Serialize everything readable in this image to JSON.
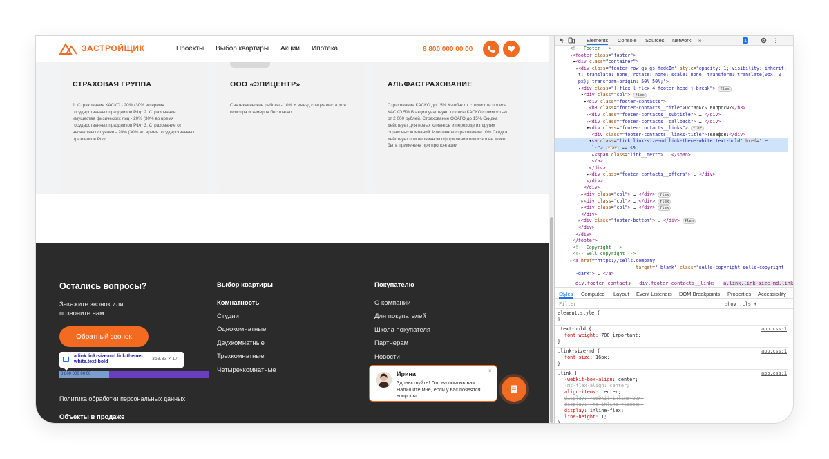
{
  "header": {
    "logo_text": "ЗАСТРОЙЩИК",
    "nav": [
      "Проекты",
      "Выбор квартиры",
      "Акции",
      "Ипотека"
    ],
    "phone": "8 800 000 00 00",
    "phone_icon": "phone-icon",
    "fav_icon": "heart-icon",
    "accent": "#f26b21"
  },
  "cards": [
    {
      "title": "СТРАХОВАЯ ГРУППА",
      "text": "1. Страхование КАСКО - 20% (30% во время государственных праздников РФ)* 2. Страхование имущества физических лиц - 20% (30% во время государственных праздников РФ)* 3. Страхование от несчастных случаев - 20% (30% во время государственных праздников РФ)*"
    },
    {
      "title": "ООО «ЭПИЦЕНТР»",
      "text": "Сантехнические работы - 10% + выезд специалиста для осмотра и замеров бесплатно"
    },
    {
      "title": "АЛЬФАСТРАХОВАНИЕ",
      "text": "Страхование КАСКО до 15% Кэшбэк от стоимости полиса КАСКО 5% В акции участвуют полисы КАСКО стоимостью от 2 000 рублей. Страхование ОСАГО до 15% Скидка действует для новых клиентов и переходе из других страховых компаний. Ипотечное страхование 10% Скидка действует при первичном оформлении полиса и не может быть применена при пролонгации"
    }
  ],
  "footer": {
    "questions_title": "Остались вопросы?",
    "questions_sub": "Закажите звонок или позвоните нам",
    "callback_btn": "Обратный звонок",
    "inspect_tooltip": {
      "name": "a.link.link-size-md.link-theme-white.text-bold",
      "dims": "363.33 × 17"
    },
    "highlighted_phone": "8 800 000 00 00",
    "policy_link": "Политика обработки персональных данных",
    "objects_title": "Объекты в продаже",
    "col_choice": {
      "title": "Выбор квартиры",
      "group": "Комнатность",
      "items": [
        "Студии",
        "Однокомнатные",
        "Двухкомнатные",
        "Трехкомнатные",
        "Четырехкомнатные"
      ]
    },
    "col_buyer": {
      "title": "Покупателю",
      "items": [
        "О компании",
        "Для покупателей",
        "Школа покупателя",
        "Партнерам",
        "Новости"
      ]
    }
  },
  "chat": {
    "name": "Ирина",
    "message": "Здравствуйте! Готова помочь вам. Напишите мне, если у вас появятся вопросы.",
    "close": "×",
    "button_icon": "chat-icon"
  },
  "devtools": {
    "tabs": [
      "Elements",
      "Console",
      "Sources",
      "Network",
      "»"
    ],
    "badge": "1",
    "dom_lines": [
      {
        "html": "<span class='cm'>&lt;!-- Footer --&gt;</span>"
      },
      {
        "html": "▾<span class='tg'>&lt;footer</span> <span class='at'>class</span>=<span class='av2'>\"footer\"</span><span class='tg'>&gt;</span>"
      },
      {
        "html": "&nbsp;▾<span class='tg'>&lt;div</span> <span class='at'>class</span>=<span class='av2'>\"container\"</span><span class='tg'>&gt;</span>"
      },
      {
        "html": "&nbsp;&nbsp;▾<span class='tg'>&lt;div</span> <span class='at'>class</span>=<span class='av2'>\"footer-row gs gs-fadeIn\"</span> <span class='at'>style</span>=<span class='av2'>\"opacity: 1; visibility: inherit;</span>"
      },
      {
        "html": "&nbsp;&nbsp;&nbsp;<span class='av2'>t; translate: none; rotate: none; scale: none; transform: translate(0px, 0</span>"
      },
      {
        "html": "&nbsp;&nbsp;&nbsp;<span class='av2'>px); transform-origin: 50% 50%;\"</span><span class='tg'>&gt;</span>"
      },
      {
        "html": "&nbsp;&nbsp;&nbsp;▾<span class='tg'>&lt;div</span> <span class='at'>class</span>=<span class='av2'>\"l-flex l-flex-4 footer-head j-break\"</span><span class='tg'>&gt;</span> <span class='fx'>flex</span>"
      },
      {
        "html": "&nbsp;&nbsp;&nbsp;&nbsp;▾<span class='tg'>&lt;div</span> <span class='at'>class</span>=<span class='av2'>\"col\"</span><span class='tg'>&gt;</span> <span class='fx'>flex</span>"
      },
      {
        "html": "&nbsp;&nbsp;&nbsp;&nbsp;&nbsp;▾<span class='tg'>&lt;div</span> <span class='at'>class</span>=<span class='av2'>\"footer-contacts\"</span><span class='tg'>&gt;</span>"
      },
      {
        "html": "&nbsp;&nbsp;&nbsp;&nbsp;&nbsp;&nbsp;&nbsp;<span class='tg'>&lt;h3</span> <span class='at'>class</span>=<span class='av2'>\"footer-contacts__title\"</span><span class='tg'>&gt;</span>Остались вопросы?<span class='tg'>&lt;/h3&gt;</span>"
      },
      {
        "html": "&nbsp;&nbsp;&nbsp;&nbsp;&nbsp;&nbsp;▸<span class='tg'>&lt;div</span> <span class='at'>class</span>=<span class='av2'>\"footer-contacts__subtitle\"</span><span class='tg'>&gt;</span> … <span class='tg'>&lt;/div&gt;</span>"
      },
      {
        "html": "&nbsp;&nbsp;&nbsp;&nbsp;&nbsp;&nbsp;▸<span class='tg'>&lt;div</span> <span class='at'>class</span>=<span class='av2'>\"footer-contacts__callback\"</span><span class='tg'>&gt;</span> … <span class='tg'>&lt;/div&gt;</span>"
      },
      {
        "html": "&nbsp;&nbsp;&nbsp;&nbsp;&nbsp;&nbsp;▾<span class='tg'>&lt;div</span> <span class='at'>class</span>=<span class='av2'>\"footer-contacts__links\"</span><span class='tg'>&gt;</span> <span class='fx'>flex</span>"
      },
      {
        "html": "&nbsp;&nbsp;&nbsp;&nbsp;&nbsp;&nbsp;&nbsp;&nbsp;<span class='tg'>&lt;div</span> <span class='at'>class</span>=<span class='av2'>\"footer-contacts__links-title\"</span><span class='tg'>&gt;</span>Телефон:<span class='tg'>&lt;/div&gt;</span>"
      },
      {
        "html": "&nbsp;&nbsp;&nbsp;&nbsp;&nbsp;&nbsp;&nbsp;▾<span class='tg'>&lt;a</span> <span class='at'>class</span>=<span class='av2'>\"link link-size-md link-theme-white text-bold\"</span> <span class='at'>href</span>=<span class='av2'>\"te</span>",
        "selected": true
      },
      {
        "html": "&nbsp;&nbsp;&nbsp;&nbsp;&nbsp;&nbsp;&nbsp;&nbsp;<span class='av2'>l:\"</span><span class='tg'>&gt;</span> <span class='fx'>flex</span> == $0",
        "selected": true
      },
      {
        "html": "&nbsp;&nbsp;&nbsp;&nbsp;&nbsp;&nbsp;&nbsp;&nbsp;▸<span class='tg'>&lt;span</span> <span class='at'>class</span>=<span class='av2'>\"link__text\"</span><span class='tg'>&gt;</span> … <span class='tg'>&lt;/span&gt;</span>"
      },
      {
        "html": "&nbsp;&nbsp;&nbsp;&nbsp;&nbsp;&nbsp;&nbsp;&nbsp;<span class='tg'>&lt;/a&gt;</span>"
      },
      {
        "html": "&nbsp;&nbsp;&nbsp;&nbsp;&nbsp;&nbsp;&nbsp;<span class='tg'>&lt;/div&gt;</span>"
      },
      {
        "html": "&nbsp;&nbsp;&nbsp;&nbsp;&nbsp;&nbsp;▸<span class='tg'>&lt;div</span> <span class='at'>class</span>=<span class='av2'>\"footer-contacts__offers\"</span><span class='tg'>&gt;</span> … <span class='tg'>&lt;/div&gt;</span>"
      },
      {
        "html": "&nbsp;&nbsp;&nbsp;&nbsp;&nbsp;&nbsp;<span class='tg'>&lt;/div&gt;</span>"
      },
      {
        "html": "&nbsp;&nbsp;&nbsp;&nbsp;&nbsp;<span class='tg'>&lt;/div&gt;</span>"
      },
      {
        "html": "&nbsp;&nbsp;&nbsp;&nbsp;▸<span class='tg'>&lt;div</span> <span class='at'>class</span>=<span class='av2'>\"col\"</span><span class='tg'>&gt;</span> … <span class='tg'>&lt;/div&gt;</span> <span class='fx'>flex</span>"
      },
      {
        "html": "&nbsp;&nbsp;&nbsp;&nbsp;▸<span class='tg'>&lt;div</span> <span class='at'>class</span>=<span class='av2'>\"col\"</span><span class='tg'>&gt;</span> … <span class='tg'>&lt;/div&gt;</span> <span class='fx'>flex</span>"
      },
      {
        "html": "&nbsp;&nbsp;&nbsp;&nbsp;▸<span class='tg'>&lt;div</span> <span class='at'>class</span>=<span class='av2'>\"col\"</span><span class='tg'>&gt;</span> … <span class='tg'>&lt;/div&gt;</span> <span class='fx'>flex</span>"
      },
      {
        "html": "&nbsp;&nbsp;&nbsp;&nbsp;<span class='tg'>&lt;/div&gt;</span>"
      },
      {
        "html": "&nbsp;&nbsp;&nbsp;▸<span class='tg'>&lt;div</span> <span class='at'>class</span>=<span class='av2'>\"footer-bottom\"</span><span class='tg'>&gt;</span> … <span class='tg'>&lt;/div&gt;</span> <span class='fx'>flex</span>"
      },
      {
        "html": "&nbsp;&nbsp;&nbsp;<span class='tg'>&lt;/div&gt;</span>"
      },
      {
        "html": "&nbsp;&nbsp;<span class='tg'>&lt;/div&gt;</span>"
      },
      {
        "html": "&nbsp;<span class='tg'>&lt;/footer&gt;</span>"
      },
      {
        "html": "&nbsp;<span class='cm'>&lt;!-- Copyright --&gt;</span>"
      },
      {
        "html": "&nbsp;<span class='cm'>&lt;!-- Sell copyright --&gt;</span>"
      },
      {
        "html": "▸<span class='tg'>&lt;a</span> <span class='at'>href</span>=<span class='av2' style='text-decoration:underline'>\"https://sells.company</span>"
      },
      {
        "html": "&nbsp;&nbsp;&nbsp;&nbsp;&nbsp;&nbsp;&nbsp;&nbsp;&nbsp;&nbsp;&nbsp;&nbsp;&nbsp;&nbsp;&nbsp;&nbsp;&nbsp;&nbsp;&nbsp;&nbsp;&nbsp;&nbsp;&nbsp;&nbsp;<span class='at'>target</span>=<span class='av2'>\"_blank\"</span> <span class='at'>class</span>=<span class='av2'>\"sells-copyright sells-copyright</span>"
      },
      {
        "html": "&nbsp;&nbsp;<span class='av2'>-dark\"</span><span class='tg'>&gt;</span> … <span class='tg'>&lt;/a&gt;</span>"
      }
    ],
    "breadcrumb": [
      "div.footer-contacts",
      "div.footer-contacts__links",
      "a.link.link-size-md.link-theme-white.text-bold"
    ],
    "style_tabs": [
      "Styles",
      "Computed",
      "Layout",
      "Event Listeners",
      "DOM Breakpoints",
      "Properties",
      "Accessibility"
    ],
    "filter_placeholder": "Filter",
    "filter_tools": ":hov  .cls  +",
    "rules": [
      {
        "selector": "element.style {",
        "source": "",
        "props": []
      },
      {
        "selector": ".text-bold {",
        "source": "app.css:1",
        "props": [
          {
            "n": "font-weight",
            "v": "700!important;"
          }
        ]
      },
      {
        "selector": ".link-size-md {",
        "source": "app.css:1",
        "props": [
          {
            "n": "font-size",
            "v": "16px;"
          }
        ]
      },
      {
        "selector": ".link {",
        "source": "app.css:1",
        "props": [
          {
            "n": "-webkit-box-align",
            "v": "center;"
          },
          {
            "n": "-ms-flex-align",
            "v": "center;",
            "strike": true
          },
          {
            "n": "align-items",
            "v": "center;"
          },
          {
            "n": "display",
            "v": "-webkit-inline-box;",
            "strike": true
          },
          {
            "n": "display",
            "v": "-ms-inline-flexbox;",
            "strike": true
          },
          {
            "n": "display",
            "v": "inline-flex;"
          },
          {
            "n": "line-height",
            "v": "1;"
          }
        ]
      }
    ]
  }
}
